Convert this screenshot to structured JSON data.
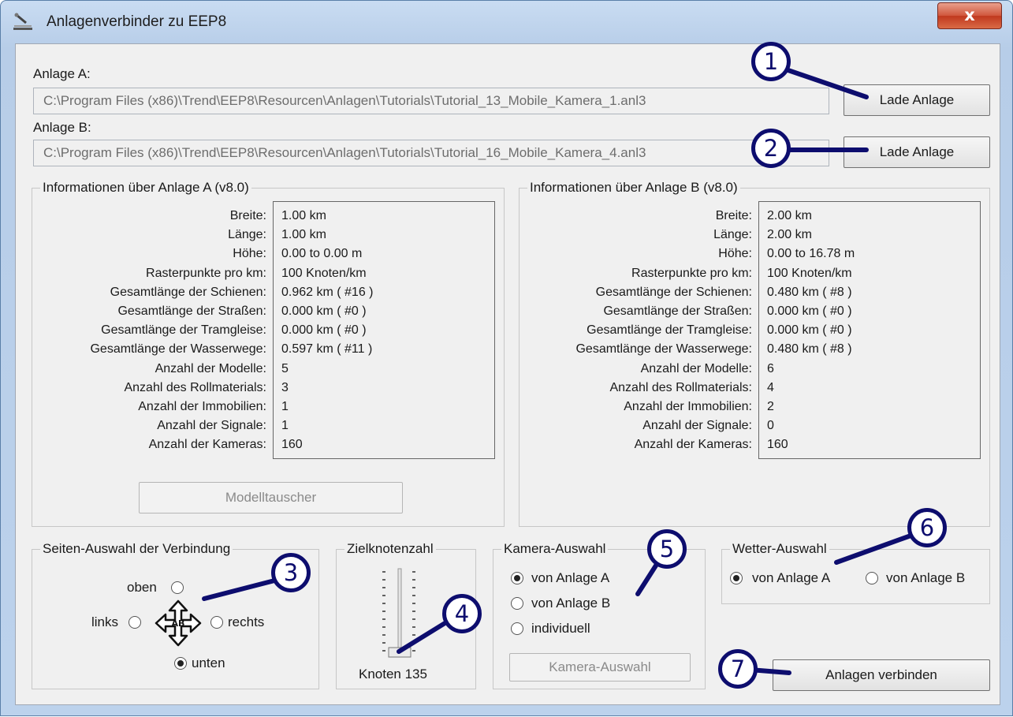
{
  "window": {
    "title": "Anlagenverbinder zu EEP8",
    "close_label": "x"
  },
  "anlage_a": {
    "label": "Anlage A:",
    "path": "C:\\Program Files (x86)\\Trend\\EEP8\\Resourcen\\Anlagen\\Tutorials\\Tutorial_13_Mobile_Kamera_1.anl3",
    "button": "Lade Anlage"
  },
  "anlage_b": {
    "label": "Anlage B:",
    "path": "C:\\Program Files (x86)\\Trend\\EEP8\\Resourcen\\Anlagen\\Tutorials\\Tutorial_16_Mobile_Kamera_4.anl3",
    "button": "Lade Anlage"
  },
  "info_a": {
    "title": "Informationen über Anlage A (v8.0)",
    "keys": [
      "Breite:",
      "Länge:",
      "Höhe:",
      "Rasterpunkte pro km:",
      "Gesamtlänge der Schienen:",
      "Gesamtlänge der Straßen:",
      "Gesamtlänge der Tramgleise:",
      "Gesamtlänge der Wasserwege:",
      "Anzahl der Modelle:",
      "Anzahl des Rollmaterials:",
      "Anzahl der Immobilien:",
      "Anzahl der Signale:",
      "Anzahl der Kameras:"
    ],
    "values": [
      "1.00 km",
      "1.00 km",
      "0.00 to 0.00 m",
      "100 Knoten/km",
      "0.962 km ( #16 )",
      "0.000 km ( #0 )",
      "0.000 km ( #0 )",
      "0.597 km ( #11 )",
      "5",
      "3",
      "1",
      "1",
      "160"
    ],
    "button": "Modelltauscher"
  },
  "info_b": {
    "title": "Informationen über Anlage B (v8.0)",
    "keys": [
      "Breite:",
      "Länge:",
      "Höhe:",
      "Rasterpunkte pro km:",
      "Gesamtlänge der Schienen:",
      "Gesamtlänge der Straßen:",
      "Gesamtlänge der Tramgleise:",
      "Gesamtlänge der Wasserwege:",
      "Anzahl der Modelle:",
      "Anzahl des Rollmaterials:",
      "Anzahl der Immobilien:",
      "Anzahl der Signale:",
      "Anzahl der Kameras:"
    ],
    "values": [
      "2.00 km",
      "2.00 km",
      "0.00 to 16.78 m",
      "100 Knoten/km",
      "0.480 km ( #8 )",
      "0.000 km ( #0 )",
      "0.000 km ( #0 )",
      "0.480 km ( #8 )",
      "6",
      "4",
      "2",
      "0",
      "160"
    ]
  },
  "seiten": {
    "title": "Seiten-Auswahl der Verbindung",
    "oben": "oben",
    "links": "links",
    "rechts": "rechts",
    "unten": "unten",
    "selected": "unten"
  },
  "ziel": {
    "title": "Zielknotenzahl",
    "readout": "Knoten 135",
    "slider_level": 0.0
  },
  "kamera": {
    "title": "Kamera-Auswahl",
    "options": [
      "von Anlage A",
      "von Anlage B",
      "individuell"
    ],
    "selected": "von Anlage A",
    "button": "Kamera-Auswahl"
  },
  "wetter": {
    "title": "Wetter-Auswahl",
    "options": [
      "von Anlage A",
      "von Anlage B"
    ],
    "selected": "von Anlage A"
  },
  "connect_button": "Anlagen verbinden",
  "callouts": [
    "1",
    "2",
    "3",
    "4",
    "5",
    "6",
    "7"
  ],
  "colors": {
    "callout": "#0d0d6e",
    "close": "#c9452a"
  }
}
